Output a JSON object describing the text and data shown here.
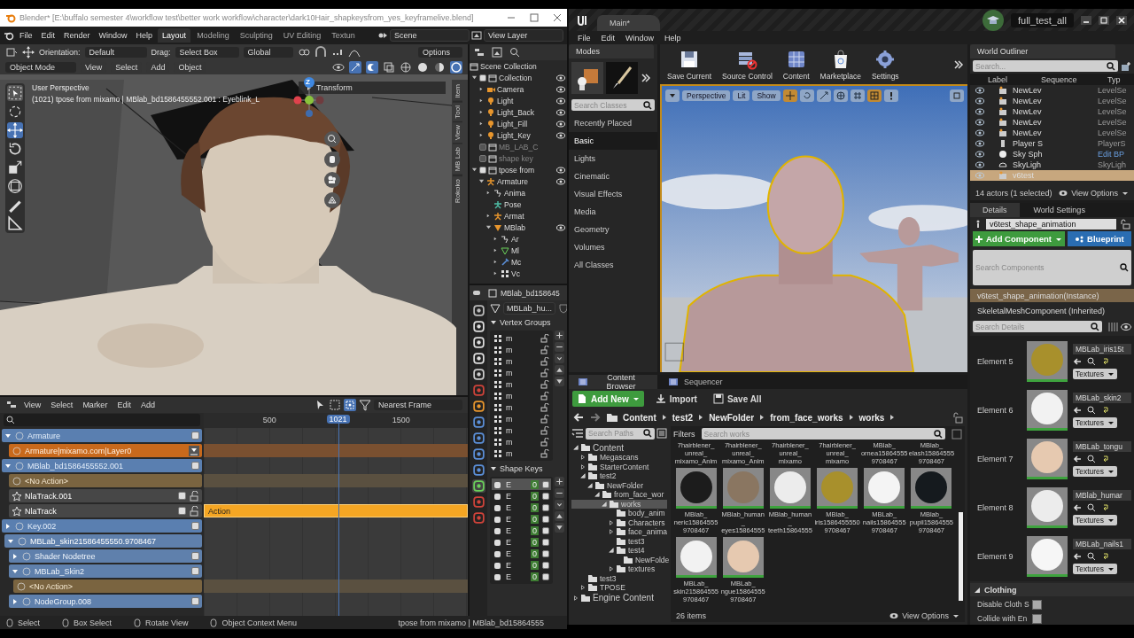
{
  "blender": {
    "title": "Blender* [E:\\buffalo semester 4\\workflow test\\better work workflow\\character\\dark10Hair_shapkeysfrom_yes_keyframelive.blend]",
    "menu": [
      "File",
      "Edit",
      "Render",
      "Window",
      "Help"
    ],
    "workspaces": [
      {
        "label": "Layout",
        "selected": true
      },
      {
        "label": "Modeling",
        "selected": false
      },
      {
        "label": "Sculpting",
        "selected": false
      },
      {
        "label": "UV Editing",
        "selected": false
      },
      {
        "label": "Textun",
        "selected": false
      }
    ],
    "scene": "Scene",
    "view_layer": "View Layer",
    "tool_header": {
      "orientation_label": "Orientation:",
      "orientation": "Default",
      "drag_label": "Drag:",
      "drag": "Select Box",
      "space": "Global",
      "options": "Options"
    },
    "mode": "Object Mode",
    "view_menus": [
      "View",
      "Select",
      "Add",
      "Object"
    ],
    "viewport": {
      "perspective": "User Perspective",
      "info": "(1021) tpose from mixamo | MBlab_bd1586455552.001 : Eyeblink_L",
      "panel": "Transform",
      "axis": "Z",
      "side_tabs": [
        "Item",
        "Tool",
        "View",
        "MB Lab",
        "Rokoko"
      ]
    },
    "outliner": {
      "root": "Scene Collection",
      "items": [
        {
          "label": "Collection",
          "kind": "collection",
          "checked": true,
          "expanded": true,
          "visible": true,
          "children": [
            {
              "label": "Camera",
              "kind": "camera",
              "expanded": false,
              "visible": true
            },
            {
              "label": "Light",
              "kind": "light",
              "expanded": false,
              "visible": true
            },
            {
              "label": "Light_Back",
              "kind": "light",
              "expanded": false,
              "visible": true
            },
            {
              "label": "Light_Fill",
              "kind": "light",
              "expanded": false,
              "visible": true
            },
            {
              "label": "Light_Key",
              "kind": "light",
              "expanded": false,
              "visible": true
            }
          ]
        },
        {
          "label": "MB_LAB_C",
          "kind": "collection",
          "checked": false,
          "visible": false
        },
        {
          "label": "shape key",
          "kind": "collection",
          "checked": false,
          "visible": false
        },
        {
          "label": "tpose from",
          "kind": "collection",
          "checked": true,
          "expanded": true,
          "visible": true,
          "children": [
            {
              "label": "Armature",
              "kind": "armature",
              "expanded": true,
              "visible": true,
              "children": [
                {
                  "label": "Anima",
                  "kind": "action",
                  "expanded": false,
                  "visible": false
                },
                {
                  "label": "Pose",
                  "kind": "pose",
                  "visible": false
                },
                {
                  "label": "Armat",
                  "kind": "armature",
                  "expanded": false,
                  "visible": false
                },
                {
                  "label": "MBlab",
                  "kind": "mesh",
                  "expanded": true,
                  "visible": true,
                  "children": [
                    {
                      "label": "Ar",
                      "kind": "action",
                      "expanded": false,
                      "visible": false
                    },
                    {
                      "label": "Ml",
                      "kind": "meshdata",
                      "expanded": false,
                      "visible": false
                    },
                    {
                      "label": "Mc",
                      "kind": "modifier",
                      "expanded": false,
                      "visible": false
                    },
                    {
                      "label": "Vc",
                      "kind": "vertex",
                      "expanded": false,
                      "visible": false
                    }
                  ]
                }
              ]
            }
          ]
        }
      ]
    },
    "properties": {
      "object": "MBlab_bd158645",
      "mesh": "MBLab_hu...",
      "tabs": [
        {
          "kind": "tool",
          "selected": false
        },
        {
          "kind": "render",
          "selected": false
        },
        {
          "kind": "output",
          "selected": false
        },
        {
          "kind": "viewlayer",
          "selected": false
        },
        {
          "kind": "scene",
          "selected": false
        },
        {
          "kind": "world",
          "selected": false
        },
        {
          "kind": "object",
          "selected": false
        },
        {
          "kind": "modifier",
          "selected": false
        },
        {
          "kind": "particles",
          "selected": false
        },
        {
          "kind": "physics",
          "selected": false
        },
        {
          "kind": "constraint",
          "selected": false
        },
        {
          "kind": "data",
          "selected": true
        },
        {
          "kind": "material",
          "selected": false
        },
        {
          "kind": "texture",
          "selected": false
        }
      ],
      "vertex_groups": {
        "title": "Vertex Groups",
        "rows": [
          "m",
          "m",
          "m",
          "m",
          "m",
          "m",
          "m",
          "m",
          "m",
          "m",
          "m"
        ]
      },
      "shape_keys": {
        "title": "Shape Keys",
        "rows": [
          {
            "name": "E",
            "value": "0",
            "checked": true,
            "selected": true
          },
          {
            "name": "E",
            "value": "0",
            "checked": true,
            "selected": false
          },
          {
            "name": "E",
            "value": "0",
            "checked": true,
            "selected": false
          },
          {
            "name": "E",
            "value": "0",
            "checked": true,
            "selected": false
          },
          {
            "name": "E",
            "value": "0",
            "checked": true,
            "selected": false
          },
          {
            "name": "E",
            "value": "0",
            "checked": true,
            "selected": false
          },
          {
            "name": "E",
            "value": "0",
            "checked": true,
            "selected": false
          },
          {
            "name": "E",
            "value": "0",
            "checked": true,
            "selected": false
          },
          {
            "name": "E",
            "value": "0",
            "checked": true,
            "selected": false
          }
        ]
      }
    },
    "nla": {
      "menus": [
        "View",
        "Select",
        "Marker",
        "Edit",
        "Add"
      ],
      "snap": "Nearest Frame",
      "ticks": [
        "500",
        "1500"
      ],
      "current": "1021",
      "tracks": [
        {
          "name": "Armature",
          "kind": "object",
          "expanded": true,
          "checked": true
        },
        {
          "name": "Armature|mixamo.com|Layer0",
          "kind": "action"
        },
        {
          "name": "MBlab_bd1586455552.001",
          "kind": "object",
          "expanded": true,
          "checked": true
        },
        {
          "name": "<No Action>",
          "kind": "noaction"
        },
        {
          "name": "NlaTrack.001",
          "kind": "track",
          "checked": true
        },
        {
          "name": "NlaTrack",
          "kind": "track",
          "checked": true,
          "strip": "Action"
        },
        {
          "name": "Key.002",
          "kind": "object",
          "expanded": false,
          "checked": true
        },
        {
          "name": "MBLab_skin21586455550.9708467",
          "kind": "material",
          "expanded": true
        },
        {
          "name": "Shader Nodetree",
          "kind": "sub",
          "expanded": false,
          "checked": true
        },
        {
          "name": "MBLab_Skin2",
          "kind": "sub",
          "expanded": true,
          "checked": true
        },
        {
          "name": "<No Action>",
          "kind": "subnoaction"
        },
        {
          "name": "NodeGroup.008",
          "kind": "sub",
          "expanded": false,
          "checked": true
        }
      ]
    },
    "status": [
      "Select",
      "Box Select",
      "Rotate View",
      "Object Context Menu"
    ],
    "status_info": "tpose from mixamo | MBlab_bd15864555"
  },
  "unreal": {
    "tab": "Main*",
    "project": "full_test_all",
    "menu": [
      "File",
      "Edit",
      "Window",
      "Help"
    ],
    "modes": {
      "title": "Modes",
      "search_placeholder": "Search Classes",
      "categories": [
        {
          "label": "Recently Placed",
          "selected": false
        },
        {
          "label": "Basic",
          "selected": true
        },
        {
          "label": "Lights",
          "selected": false
        },
        {
          "label": "Cinematic",
          "selected": false
        },
        {
          "label": "Visual Effects",
          "selected": false
        },
        {
          "label": "Media",
          "selected": false
        },
        {
          "label": "Geometry",
          "selected": false
        },
        {
          "label": "Volumes",
          "selected": false
        },
        {
          "label": "All Classes",
          "selected": false
        }
      ]
    },
    "toolbar": [
      {
        "label": "Save Current",
        "kind": "save"
      },
      {
        "label": "Source Control",
        "kind": "source"
      },
      {
        "label": "Content",
        "kind": "content"
      },
      {
        "label": "Marketplace",
        "kind": "market"
      },
      {
        "label": "Settings",
        "kind": "settings"
      }
    ],
    "viewport": {
      "buttons": [
        "Perspective",
        "Lit",
        "Show"
      ]
    },
    "content_browser": {
      "tabs": [
        {
          "label": "Content Browser",
          "selected": true
        },
        {
          "label": "Sequencer",
          "selected": false
        }
      ],
      "actions": [
        {
          "label": "Add New",
          "kind": "add"
        },
        {
          "label": "Import",
          "kind": "import"
        },
        {
          "label": "Save All",
          "kind": "save"
        }
      ],
      "path": [
        "Content",
        "test2",
        "NewFolder",
        "from_face_works",
        "works"
      ],
      "paths_placeholder": "Search Paths",
      "filters": "Filters",
      "search_placeholder": "Search works",
      "tree": [
        {
          "label": "Content",
          "expanded": true,
          "selected": false,
          "children": [
            {
              "label": "Megascans",
              "expanded": false,
              "selected": false
            },
            {
              "label": "StarterContent",
              "expanded": false,
              "selected": false
            },
            {
              "label": "test2",
              "expanded": true,
              "selected": false,
              "children": [
                {
                  "label": "NewFolder",
                  "expanded": true,
                  "selected": false,
                  "children": [
                    {
                      "label": "from_face_wor",
                      "expanded": true,
                      "selected": false,
                      "children": [
                        {
                          "label": "works",
                          "expanded": true,
                          "selected": true,
                          "children": [
                            {
                              "label": "body_anim",
                              "selected": false
                            },
                            {
                              "label": "Characters",
                              "expanded": false,
                              "selected": false
                            },
                            {
                              "label": "face_anima",
                              "expanded": false,
                              "selected": false
                            },
                            {
                              "label": "test3",
                              "selected": false
                            },
                            {
                              "label": "test4",
                              "expanded": true,
                              "selected": false,
                              "children": [
                                {
                                  "label": "NewFolde",
                                  "selected": false
                                }
                              ]
                            },
                            {
                              "label": "textures",
                              "expanded": false,
                              "selected": false
                            }
                          ]
                        }
                      ]
                    }
                  ]
                }
              ]
            },
            {
              "label": "test3",
              "selected": false
            },
            {
              "label": "TPOSE",
              "expanded": false,
              "selected": false
            }
          ]
        },
        {
          "label": "Engine Content",
          "expanded": false,
          "selected": false
        }
      ],
      "assets": [
        {
          "kind": "label",
          "lines": [
            "7hairblener_",
            "unreal_",
            "mixamo_Anim"
          ]
        },
        {
          "kind": "label",
          "lines": [
            "7hairblener_",
            "unreal_",
            "mixamo_Anim"
          ]
        },
        {
          "kind": "label",
          "lines": [
            "7hairblener_",
            "unreal_",
            "mixamo"
          ]
        },
        {
          "kind": "label",
          "lines": [
            "7hairblener_",
            "unreal_",
            "mixamo"
          ]
        },
        {
          "kind": "label",
          "lines": [
            "MBlab_",
            "ornea15864555",
            "9708467"
          ]
        },
        {
          "kind": "label",
          "lines": [
            "MBlab_",
            "elash15864555",
            "9708467"
          ]
        },
        {
          "kind": "material",
          "color": "#1c1c1c",
          "lines": [
            "MBlab_",
            "neric15864555",
            "9708467"
          ]
        },
        {
          "kind": "material",
          "color": "#8a7661",
          "lines": [
            "MBlab_human",
            "_",
            "eyes15864555"
          ]
        },
        {
          "kind": "material",
          "color": "#ececec",
          "lines": [
            "MBlab_human",
            "_",
            "teeth15864555"
          ]
        },
        {
          "kind": "material",
          "color": "#a8902c",
          "lines": [
            "MBlab_",
            "iris1586455550",
            "9708467"
          ]
        },
        {
          "kind": "material",
          "color": "#f4f4f4",
          "lines": [
            "MBLab_",
            "nails15864555",
            "9708467"
          ]
        },
        {
          "kind": "material",
          "color": "#151a1e",
          "lines": [
            "MBlab_",
            "pupil15864555",
            "9708467"
          ]
        },
        {
          "kind": "material",
          "color": "#f2f2f2",
          "lines": [
            "MBLab_",
            "skin215864555",
            "9708467"
          ]
        },
        {
          "kind": "material",
          "color": "#e6c9b0",
          "lines": [
            "MBLab_",
            "ngue15864555",
            "9708467"
          ]
        }
      ],
      "count": "26 items",
      "view_options": "View Options"
    },
    "outliner": {
      "title": "World Outliner",
      "search_placeholder": "Search...",
      "columns": [
        "Label",
        "Sequence",
        "Typ"
      ],
      "rows": [
        {
          "label": "NewLev",
          "type": "LevelSe",
          "kind": "level",
          "selected": false
        },
        {
          "label": "NewLev",
          "type": "LevelSe",
          "kind": "level",
          "selected": false
        },
        {
          "label": "NewLev",
          "type": "LevelSe",
          "kind": "level",
          "selected": false
        },
        {
          "label": "NewLev",
          "type": "LevelSe",
          "kind": "level",
          "selected": false
        },
        {
          "label": "NewLev",
          "type": "LevelSe",
          "kind": "level",
          "selected": false
        },
        {
          "label": "Player S",
          "type": "PlayerS",
          "kind": "player",
          "selected": false
        },
        {
          "label": "Sky Sph",
          "type": "Edit BP",
          "kind": "sky",
          "selected": false
        },
        {
          "label": "SkyLigh",
          "type": "SkyLigh",
          "kind": "skylight",
          "selected": false
        },
        {
          "label": "v6test",
          "type": "",
          "kind": "level",
          "selected": true
        }
      ],
      "count": "14 actors (1 selected)",
      "view_options": "View Options"
    },
    "details": {
      "tabs": [
        {
          "label": "Details",
          "selected": true
        },
        {
          "label": "World Settings",
          "selected": false
        }
      ],
      "actor": "v6test_shape_animation",
      "add": "Add Component",
      "blueprint": "Blueprint",
      "components_placeholder": "Search Components",
      "components": [
        {
          "label": "v6test_shape_animation(Instance)",
          "selected": true
        },
        {
          "label": "SkeletalMeshComponent (Inherited)",
          "selected": false
        }
      ],
      "details_placeholder": "Search Details",
      "elements": [
        {
          "label": "Element 5",
          "material": "MBLab_iris15t",
          "color": "#a8902c",
          "textures": "Textures"
        },
        {
          "label": "Element 6",
          "material": "MBLab_skin2",
          "color": "#f2f2f2",
          "textures": "Textures"
        },
        {
          "label": "Element 7",
          "material": "MBLab_tongu",
          "color": "#e6c9b0",
          "textures": "Textures"
        },
        {
          "label": "Element 8",
          "material": "MBlab_humar",
          "color": "#ececec",
          "textures": "Textures"
        },
        {
          "label": "Element 9",
          "material": "MBLab_nails1",
          "color": "#f6f6f6",
          "textures": "Textures"
        }
      ],
      "section": "Clothing",
      "props": [
        {
          "label": "Disable Cloth S",
          "checked": false
        },
        {
          "label": "Collide with En",
          "checked": false
        }
      ]
    }
  }
}
